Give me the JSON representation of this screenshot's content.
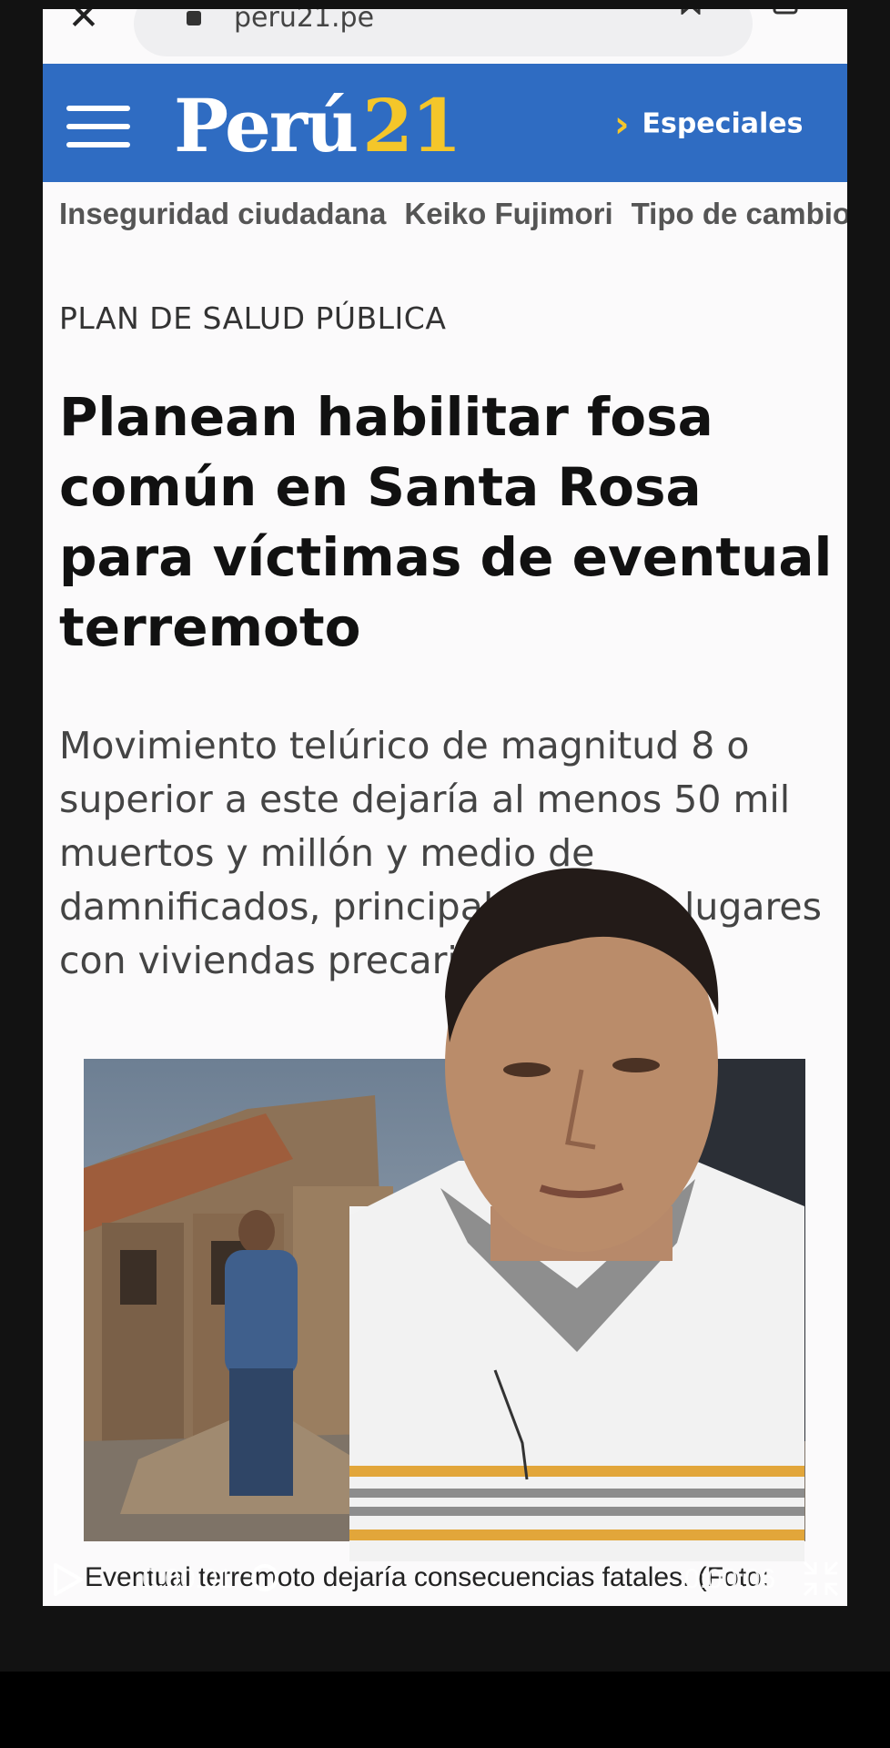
{
  "browser": {
    "url": "peru21.pe"
  },
  "site": {
    "logo_part1": "Perú",
    "logo_part2": "21",
    "especiales": "Especiales"
  },
  "topics": [
    "Inseguridad ciudadana",
    "Keiko Fujimori",
    "Tipo de cambio"
  ],
  "article": {
    "kicker": "PLAN DE SALUD PÚBLICA",
    "headline": "Planean habilitar fosa común en Santa Rosa para víctimas de eventual terremoto",
    "summary": "Movimiento telúrico de magnitud 8 o superior a este dejaría al menos 50 mil muertos y millón y medio de damnificados, principalmente en lugares con viviendas precarias",
    "caption": "Eventual terremoto dejaría consecuencias fatales. (Foto:"
  },
  "player": {
    "current_time": "0:00:01",
    "total_time": "0:00:06",
    "progress_fraction": 0.17
  },
  "colors": {
    "header_blue": "#2f6cc2",
    "logo_yellow": "#f4c62a"
  }
}
